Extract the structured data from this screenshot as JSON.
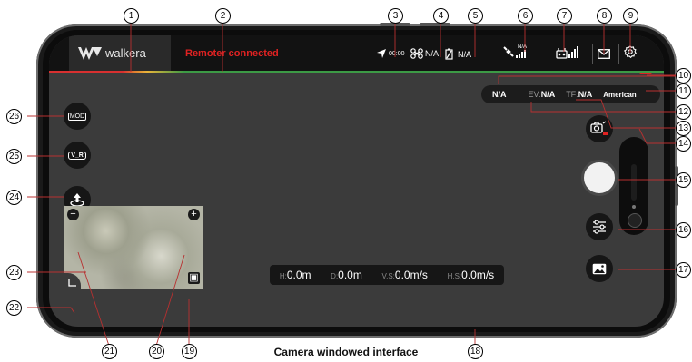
{
  "topbar": {
    "brand": "walkera",
    "status": "Remoter connected",
    "gps_time": "00:00",
    "drone_signal": "N/A",
    "satellites": "N/A",
    "rc_signal_label": "N/A"
  },
  "info": {
    "mode_value": "N/A",
    "ev_label": "EV:",
    "ev_value": "N/A",
    "tf_label": "TF:",
    "tf_value": "N/A",
    "region": "American"
  },
  "left_buttons": {
    "mod": "MOD",
    "vr": "V_R"
  },
  "telemetry": {
    "h_label": "H:",
    "h_value": "0.0m",
    "d_label": "D:",
    "d_value": "0.0m",
    "vs_label": "V.S:",
    "vs_value": "0.0m/s",
    "hs_label": "H.S:",
    "hs_value": "0.0m/s"
  },
  "caption": "Camera windowed interface",
  "callouts": [
    "1",
    "2",
    "3",
    "4",
    "5",
    "6",
    "7",
    "8",
    "9",
    "10",
    "11",
    "12",
    "13",
    "14",
    "15",
    "16",
    "17",
    "18",
    "19",
    "20",
    "21",
    "22",
    "23",
    "24",
    "25",
    "26"
  ],
  "icons": [
    "walkera-logo-icon",
    "gps-arrow-icon",
    "drone-icon",
    "battery-icon",
    "satellite-icon",
    "remote-icon",
    "mail-icon",
    "gear-icon",
    "camera-switch-icon",
    "shutter-icon",
    "settings-sliders-icon",
    "gallery-icon",
    "takeoff-icon",
    "zoom-out-icon",
    "zoom-in-icon",
    "expand-icon",
    "collapse-icon"
  ],
  "colors": {
    "status_red": "#e02222",
    "screen_bg": "#3b3b3b",
    "bar_bg": "#121212"
  }
}
